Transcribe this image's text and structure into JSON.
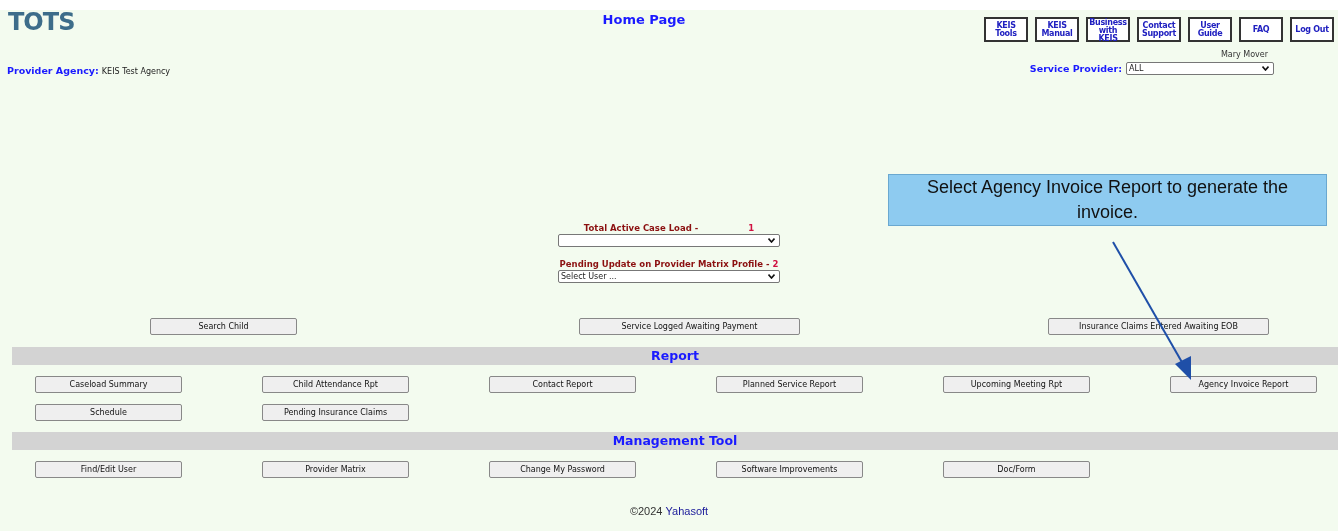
{
  "logo": {
    "text": "TOTS"
  },
  "title": "Home Page",
  "nav_buttons": [
    "KEIS Tools",
    "KEIS Manual",
    "Business with KEIS",
    "Contact Support",
    "User Guide",
    "FAQ",
    "Log Out"
  ],
  "user_name": "Mary Mover",
  "provider_agency": {
    "label": "Provider Agency:",
    "value": "KEIS Test Agency"
  },
  "service_provider": {
    "label": "Service Provider:",
    "value": "ALL"
  },
  "callout": {
    "text": "Select Agency Invoice Report to generate the invoice."
  },
  "case_load": {
    "label": "Total Active Case Load -",
    "count": "1"
  },
  "pending_update": {
    "label": "Pending Update on Provider Matrix Profile -",
    "count": "2",
    "value": "Select User ..."
  },
  "quick_buttons": [
    "Search Child",
    "Service Logged Awaiting Payment",
    "Insurance Claims Entered Awaiting EOB"
  ],
  "sections": [
    {
      "title": "Report",
      "buttons": [
        "Caseload Summary",
        "Child Attendance Rpt",
        "Contact Report",
        "Planned Service Report",
        "Upcoming Meeting Rpt",
        "Agency Invoice Report",
        "Schedule",
        "Pending Insurance Claims"
      ]
    },
    {
      "title": "Management Tool",
      "buttons": [
        "Find/Edit User",
        "Provider Matrix",
        "Change My Password",
        "Software Improvements",
        "Doc/Form"
      ]
    }
  ],
  "footer": {
    "prefix": "©2024",
    "link": "Yahasoft"
  }
}
